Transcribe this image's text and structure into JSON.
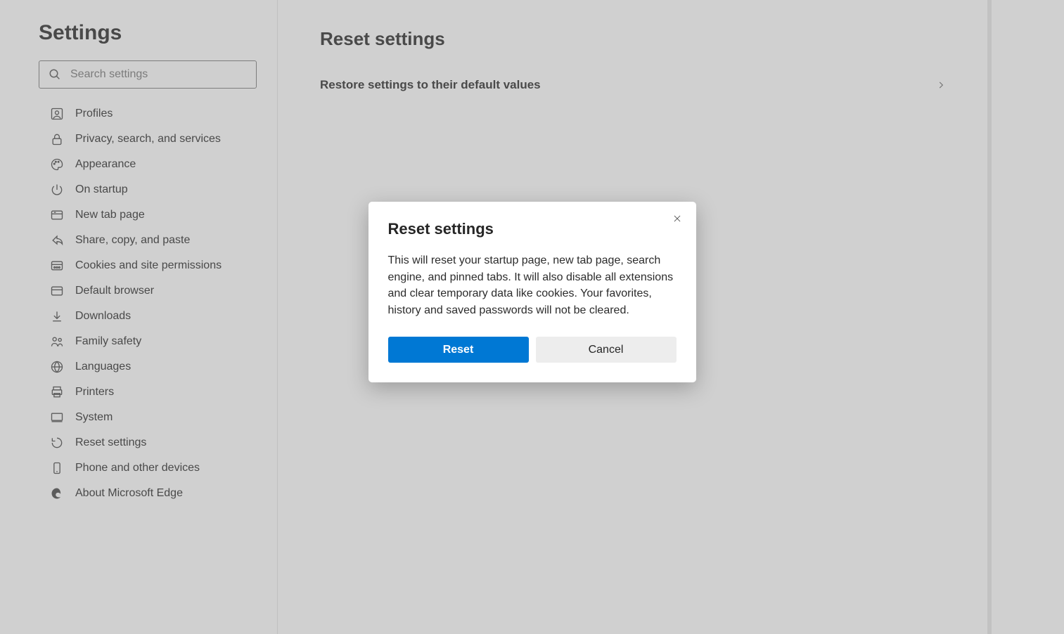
{
  "sidebar": {
    "title": "Settings",
    "search_placeholder": "Search settings",
    "items": [
      {
        "label": "Profiles"
      },
      {
        "label": "Privacy, search, and services"
      },
      {
        "label": "Appearance"
      },
      {
        "label": "On startup"
      },
      {
        "label": "New tab page"
      },
      {
        "label": "Share, copy, and paste"
      },
      {
        "label": "Cookies and site permissions"
      },
      {
        "label": "Default browser"
      },
      {
        "label": "Downloads"
      },
      {
        "label": "Family safety"
      },
      {
        "label": "Languages"
      },
      {
        "label": "Printers"
      },
      {
        "label": "System"
      },
      {
        "label": "Reset settings"
      },
      {
        "label": "Phone and other devices"
      },
      {
        "label": "About Microsoft Edge"
      }
    ]
  },
  "main": {
    "title": "Reset settings",
    "restore_label": "Restore settings to their default values"
  },
  "modal": {
    "title": "Reset settings",
    "body": "This will reset your startup page, new tab page, search engine, and pinned tabs. It will also disable all extensions and clear temporary data like cookies. Your favorites, history and saved passwords will not be cleared.",
    "reset_label": "Reset",
    "cancel_label": "Cancel"
  }
}
